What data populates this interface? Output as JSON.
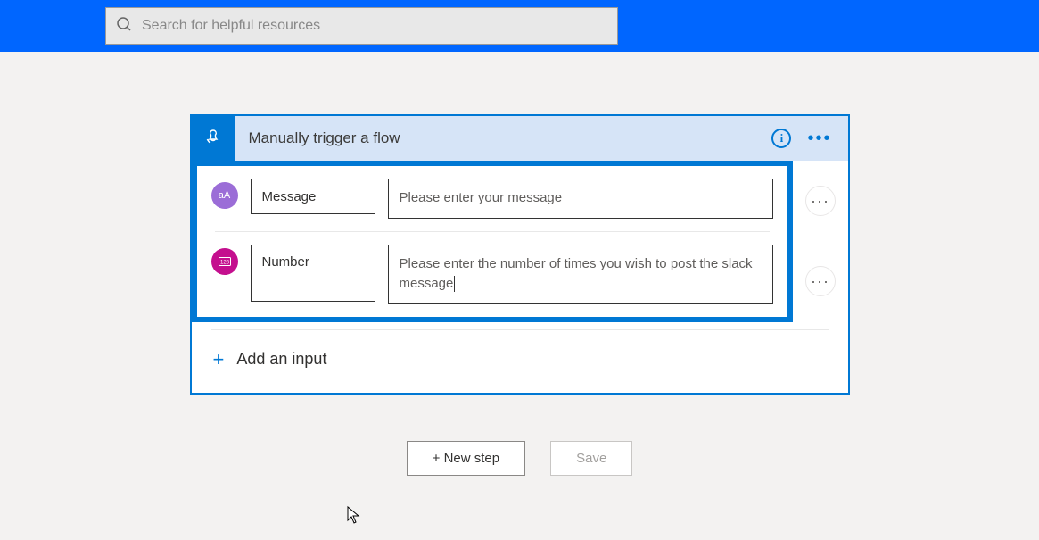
{
  "header": {
    "search_placeholder": "Search for helpful resources"
  },
  "trigger": {
    "title": "Manually trigger a flow",
    "inputs": [
      {
        "icon_label": "aA",
        "name": "Message",
        "description": "Please enter your message"
      },
      {
        "icon_label": "123",
        "name": "Number",
        "description": "Please enter the number of times you wish to post the slack message"
      }
    ],
    "add_input_label": "Add an input"
  },
  "footer": {
    "new_step": "+ New step",
    "save": "Save"
  }
}
